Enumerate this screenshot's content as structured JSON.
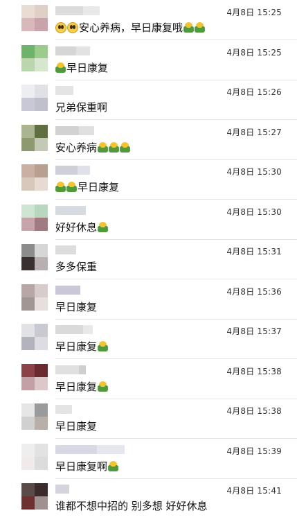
{
  "comments": [
    {
      "time": "4月8日 15:25",
      "parts": [
        {
          "emoji": "face"
        },
        {
          "emoji": "face"
        },
        {
          "text": "安心养病，早日康复哦"
        },
        {
          "emoji": "fist"
        },
        {
          "emoji": "fist"
        }
      ]
    },
    {
      "time": "4月8日 15:25",
      "parts": [
        {
          "emoji": "fist"
        },
        {
          "text": "早日康复"
        }
      ]
    },
    {
      "time": "4月8日 15:26",
      "parts": [
        {
          "text": "兄弟保重啊"
        }
      ]
    },
    {
      "time": "4月8日 15:27",
      "parts": [
        {
          "text": "安心养病"
        },
        {
          "emoji": "fist"
        },
        {
          "emoji": "fist"
        },
        {
          "emoji": "fist"
        }
      ]
    },
    {
      "time": "4月8日 15:30",
      "parts": [
        {
          "emoji": "fist"
        },
        {
          "emoji": "fist"
        },
        {
          "text": "早日康复"
        }
      ]
    },
    {
      "time": "4月8日 15:30",
      "parts": [
        {
          "text": "好好休息"
        },
        {
          "emoji": "fist"
        }
      ]
    },
    {
      "time": "4月8日 15:31",
      "parts": [
        {
          "text": "多多保重"
        }
      ]
    },
    {
      "time": "4月8日 15:36",
      "parts": [
        {
          "text": "早日康复"
        }
      ]
    },
    {
      "time": "4月8日 15:37",
      "parts": [
        {
          "text": "早日康复"
        },
        {
          "emoji": "fist"
        }
      ]
    },
    {
      "time": "4月8日 15:38",
      "parts": [
        {
          "text": "早日康复"
        },
        {
          "emoji": "fist"
        }
      ]
    },
    {
      "time": "4月8日 15:38",
      "parts": [
        {
          "text": "早日康复"
        }
      ]
    },
    {
      "time": "4月8日 15:39",
      "parts": [
        {
          "text": "早日康复啊"
        },
        {
          "emoji": "fist"
        }
      ]
    },
    {
      "time": "4月8日 15:41",
      "parts": [
        {
          "text": "谁都不想中招的 别多想 好好休息"
        }
      ]
    }
  ],
  "icons": {
    "face": "smiling-face-emoji-icon",
    "fist": "fist-salute-emoji-icon"
  },
  "colors": {
    "divider": "#e6e6e6",
    "background": "#ffffff",
    "text": "#111111",
    "time": "#333333"
  }
}
